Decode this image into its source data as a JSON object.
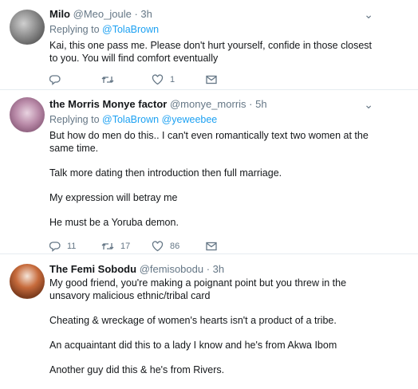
{
  "tweets": [
    {
      "name": "Milo",
      "handle": "@Meo_joule",
      "time": "· 3h",
      "reply_prefix": "Replying to",
      "reply_to": [
        "@TolaBrown"
      ],
      "paragraphs": [
        "Kai, this one pass me. Please don't hurt yourself, confide in those closest to you. You will find comfort eventually"
      ],
      "counts": {
        "replies": "",
        "retweets": "",
        "likes": "1"
      }
    },
    {
      "name": "the Morris Monye factor",
      "handle": "@monye_morris",
      "time": "· 5h",
      "reply_prefix": "Replying to",
      "reply_to": [
        "@TolaBrown",
        "@yeweebee"
      ],
      "paragraphs": [
        "But how do men do this.. I can't even romantically text two women at the same time.",
        "Talk more dating then introduction then full marriage.",
        "My expression will betray me",
        "He must be a Yoruba demon."
      ],
      "counts": {
        "replies": "11",
        "retweets": "17",
        "likes": "86"
      }
    },
    {
      "name": "The Femi Sobodu",
      "handle": "@femisobodu",
      "time": "· 3h",
      "paragraphs": [
        "My good friend, you're making a poignant point but you threw in the unsavory malicious ethnic/tribal card",
        "Cheating & wreckage of women's hearts isn't a product of a tribe.",
        "An acquaintant did this to a lady I know and he's from Akwa Ibom",
        "Another guy did this & he's from Rivers."
      ]
    }
  ],
  "icons": {
    "reply": "reply-icon",
    "retweet": "retweet-icon",
    "like": "heart-icon",
    "dm": "envelope-icon",
    "menu": "chevron-down-icon"
  },
  "colors": {
    "link": "#1da1f2",
    "muted": "#657786",
    "divider": "#e6ecf0"
  }
}
